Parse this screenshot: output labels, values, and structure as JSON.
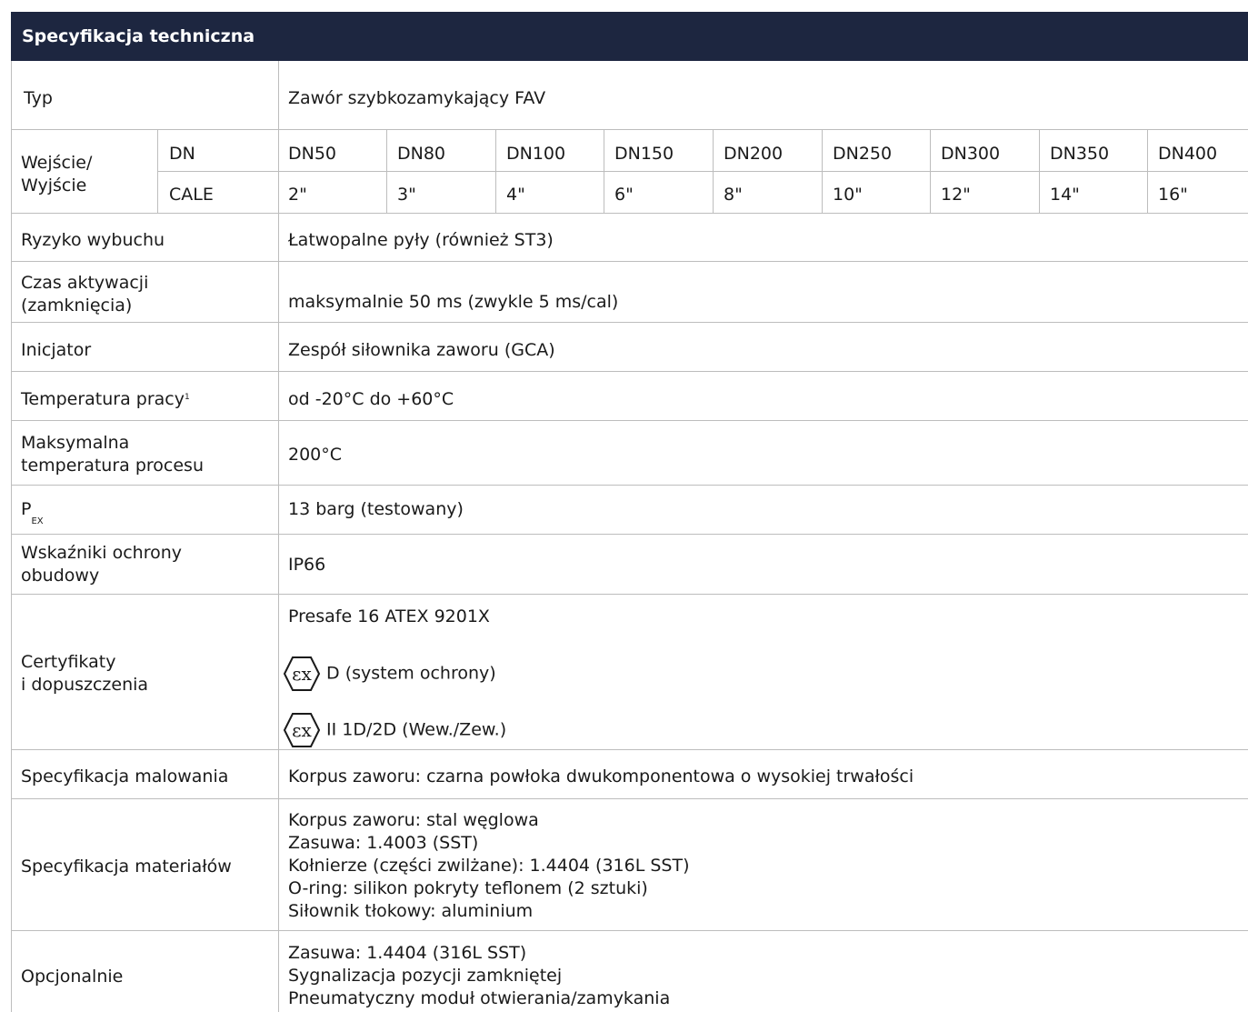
{
  "title": "Specyfikacja techniczna",
  "typ": {
    "label": "Typ",
    "value": "Zawór szybkozamykający FAV"
  },
  "io": {
    "label": "Wejście/\nWyjście",
    "dn_label": "DN",
    "cale_label": "CALE",
    "dn": [
      "DN50",
      "DN80",
      "DN100",
      "DN150",
      "DN200",
      "DN250",
      "DN300",
      "DN350",
      "DN400"
    ],
    "cale": [
      "2\"",
      "3\"",
      "4\"",
      "6\"",
      "8\"",
      "10\"",
      "12\"",
      "14\"",
      "16\""
    ]
  },
  "ryzyko": {
    "label": "Ryzyko wybuchu",
    "value": "Łatwopalne pyły (również ST3)"
  },
  "czas": {
    "label": "Czas aktywacji\n(zamknięcia)",
    "value": "maksymalnie 50 ms (zwykle 5 ms/cal)"
  },
  "inicjator": {
    "label": "Inicjator",
    "value": "Zespół siłownika zaworu (GCA)"
  },
  "temp_pracy": {
    "label": "Temperatura pracy",
    "footnote": "1",
    "value": "od -20°C do +60°C"
  },
  "max_temp": {
    "label": "Maksymalna\ntemperatura procesu",
    "value": "200°C"
  },
  "pex": {
    "label": "P",
    "sub": "EX",
    "value": "13 barg (testowany)"
  },
  "ochrona": {
    "label": "Wskaźniki ochrony\nobudowy",
    "value": "IP66"
  },
  "certyfikaty": {
    "label": "Certyfikaty\ni dopuszczenia",
    "line1": "Presafe 16 ATEX 9201X",
    "line2": "D (system ochrony)",
    "line3": "II 1D/2D (Wew./Zew.)",
    "icon": "ex-atex-icon"
  },
  "malowanie": {
    "label": "Specyfikacja malowania",
    "value": "Korpus zaworu: czarna powłoka dwukomponentowa o wysokiej trwałości"
  },
  "materialy": {
    "label": "Specyfikacja materiałów",
    "value": "Korpus zaworu: stal węglowa\nZasuwa: 1.4003 (SST)\nKołnierze (części zwilżane): 1.4404 (316L SST)\nO-ring: silikon pokryty teflonem (2 sztuki)\nSiłownik tłokowy: aluminium"
  },
  "opcjonalnie": {
    "label": "Opcjonalnie",
    "value": "Zasuwa: 1.4404 (316L SST)\nSygnalizacja pozycji zamkniętej\nPneumatyczny moduł otwierania/zamykania"
  },
  "colors": {
    "header_bg": "#1d2640",
    "header_text": "#ffffff",
    "grid": "#bdbdbd",
    "text": "#1a1a1a"
  }
}
